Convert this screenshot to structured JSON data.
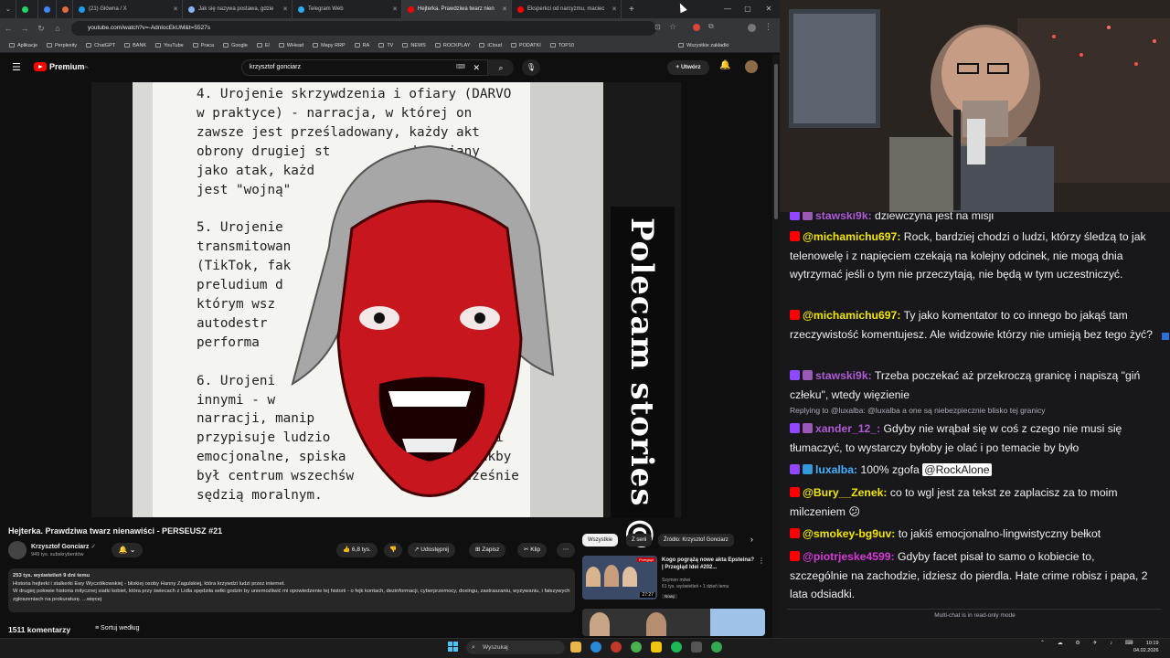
{
  "browser": {
    "tabs": [
      {
        "label": "(21) Główna / X",
        "color": "#1d9bf0"
      },
      {
        "label": "Jak się nazywa postawa, gdzie",
        "color": "#8ab4f8"
      },
      {
        "label": "Telegram Web",
        "color": "#2aabee"
      },
      {
        "label": "Hejterka. Prawdziwa twarz nien",
        "color": "#ff0000"
      },
      {
        "label": "Eksperkci od narcyzmu, maciec",
        "color": "#ff0000"
      }
    ],
    "new_tab": "+",
    "url": "youtube.com/watch?v=-AdnlocEkUM&t=5527s",
    "bookmarks": [
      "Aplikacje",
      "Perplexity",
      "ChatGPT",
      "BANK",
      "YouTube",
      "Praca",
      "Google",
      "El",
      "WHead",
      "Mapy RRP",
      "RA",
      "TV",
      "NEWS",
      "ROCKPLAY",
      "iCloud",
      "PODATKI",
      "TOP10"
    ],
    "all_bookmarks": "Wszystkie zakładki"
  },
  "youtube": {
    "logo": "Premium",
    "logo_suffix": "PL",
    "search_value": "krzysztof gonciarz",
    "create_label": "Utwórz",
    "video_text": "4. Urojenie skrzywdzenia i ofiary (DARVO\nw praktyce) - narracja, w której on\nzawsze jest prześladowany, każdy akt\nobrony drugiej st          dstawiany\njako atak, każd                 granic\njest \"wojną\"\n\n5. Urojenie\ntransmitowan\n(TikTok, fak\npreludium d\nktórym wsz\nautodestr\nperforma\n\n6. Urojeni                         yad\ninnymi - w\nnarracji, manip\nprzypisuje ludzio                 nerki\nemocjonalne, spiska                jakby\nbył centrum wszechśw            nocześnie\nsędzią moralnym.",
    "poster_text": "Polecam stories @",
    "title": "Hejterka. Prawdziwa twarz nienawiści - PERSEUSZ #21",
    "channel": "Krzysztof Gonciarz",
    "subscribers": "949 tys. subskrybentów",
    "likes": "6,8 tys.",
    "share": "Udostępnij",
    "save": "Zapisz",
    "clip": "Klip",
    "more": "⋯",
    "desc_meta": "253 tys. wyświetleń  9 dni temu",
    "desc_line1": "Historia hejterki i stalkerki Ewy Wyczółkowskiej - bliskiej osoby Hanny Zagulskiej, która krzywdzi ludzi przez internet.",
    "desc_line2": "W drugiej połowie historia mitycznej siatki kobiet, która przy świecach z Lidla spędziła setki godzin by uniemożliwić mi opowiedzenie tej historii - o fejk kontach, dezinformacji, cyberprzemocy, doxingu, zastraszaniu, wyzywaniu, i fałszywych zgłoszeniach na prokuraturę. ...więcej",
    "comments_count": "1511 komentarzy",
    "sort_label": "Sortuj według",
    "chips": [
      "Wszystkie",
      "Z serii",
      "Źródło: Krzysztof Gonciarz"
    ],
    "rec1_title": "Kogo pogrążą nowe akta Epsteina? | Przegląd Idei #202...",
    "rec1_channel": "Szymon mówi",
    "rec1_meta": "61 tys. wyświetleń • 1 dzień temu",
    "rec1_badge": "Nowy",
    "rec1_duration": "27:27",
    "rec1_tag": "Przegląd"
  },
  "chat": {
    "messages": [
      {
        "platform": "twitch",
        "user": "stawski9k:",
        "text": "dziewczyna jest na misji",
        "color": "#b05bd6"
      },
      {
        "platform": "youtube",
        "user": "@michamichu697:",
        "text": "Rock, bardziej chodzi o ludzi, którzy śledzą to jak telenowelę i z napięciem czekają na kolejny odcinek, nie mogą dnia wytrzymać jeśli o tym nie przeczytają, nie będą w tym uczestniczyć.",
        "color": "#f2e600"
      },
      {
        "platform": "youtube",
        "user": "@michamichu697:",
        "text": "Ty jako komentator to co innego bo jakąś tam rzeczywistość komentujesz. Ale widzowie którzy nie umieją bez tego żyć?",
        "color": "#f2e600"
      },
      {
        "platform": "twitch",
        "user": "stawski9k:",
        "text": "Trzeba poczekać aż przekroczą granicę i napiszą \"giń człeku\", wtedy więzienie",
        "color": "#b05bd6"
      },
      {
        "platform": "twitch",
        "user": "xander_12_:",
        "text": "Gdyby nie wrąbał się w coś z czego nie musi się tłumaczyć, to wystarczy byłoby je olać i po temacie by było",
        "color": "#b05bd6"
      },
      {
        "platform": "twitch",
        "user": "luxalba:",
        "text": "100% zgofa",
        "color": "#45b0ff"
      },
      {
        "platform": "youtube",
        "user": "@Bury__Zenek:",
        "text": "co to wgl jest za tekst ze zaplacisz za to moim milczeniem 😕",
        "color": "#f2e600"
      },
      {
        "platform": "youtube",
        "user": "@smokey-bg9uv:",
        "text": "to jakiś emocjonalno-lingwistyczny bełkot",
        "color": "#f2e600"
      },
      {
        "platform": "youtube",
        "user": "@piotrjeske4599:",
        "text": "Gdyby facet pisał to samo o kobiecie to, szczególnie na zachodzie, idziesz do pierdla. Hate crime robisz i papa, 2 lata odsiadki.",
        "color": "#d63ad6"
      }
    ],
    "reply_to": "Replying to @luxalba: @luxalba a one są niebezpiecznie blisko tej granicy",
    "mention": "@RockAlone",
    "read_only": "Multi-chat is in read-only mode"
  },
  "taskbar": {
    "search_placeholder": "Wyszukaj",
    "time": "10:19",
    "date": "04.02.2026"
  }
}
